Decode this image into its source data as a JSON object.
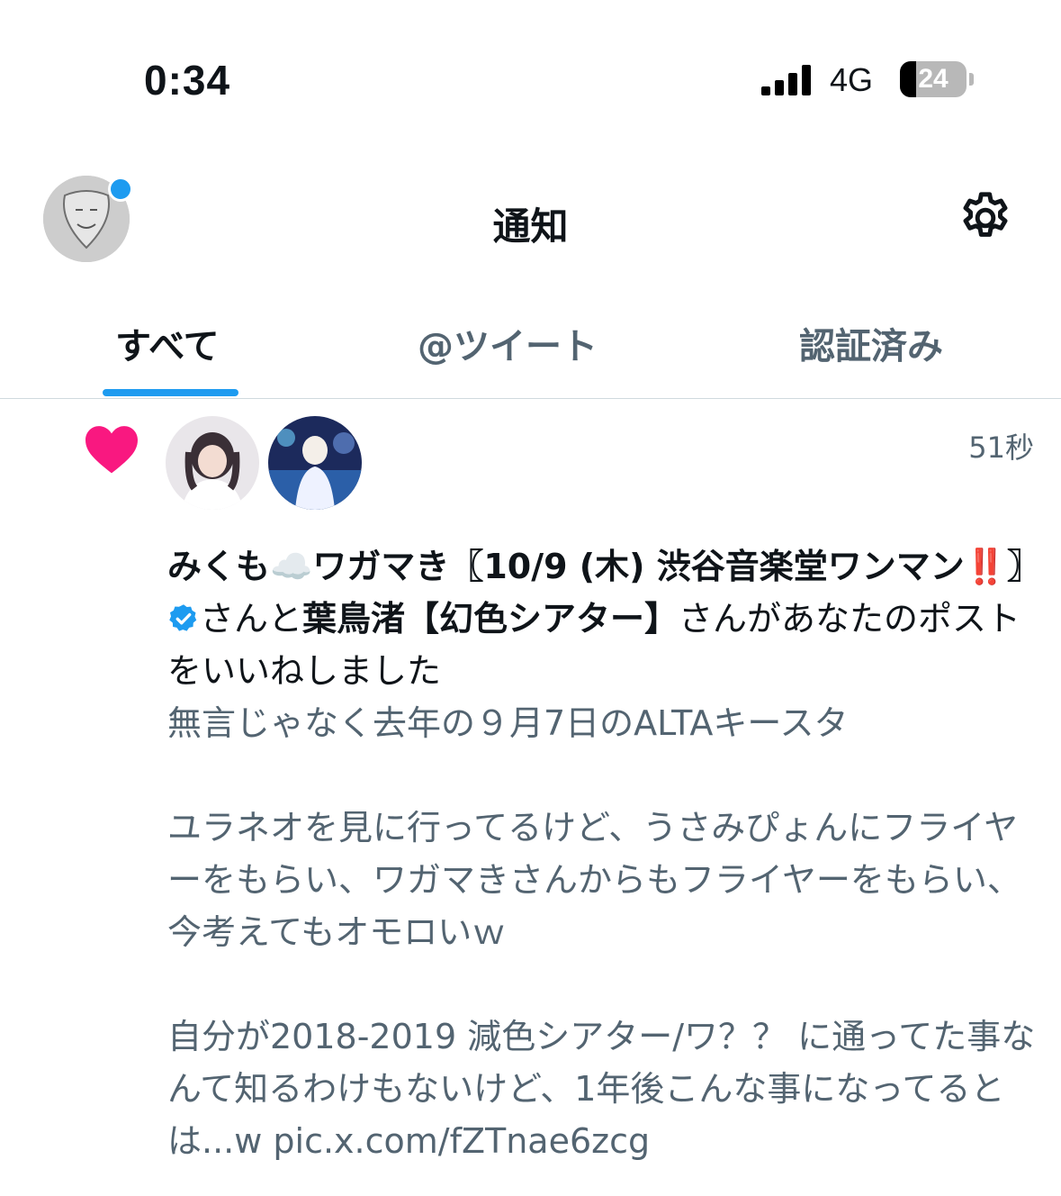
{
  "status_bar": {
    "time": "0:34",
    "network": "4G",
    "battery": "24",
    "battery_level": 0.24
  },
  "header": {
    "title": "通知"
  },
  "tabs": [
    {
      "label": "すべて",
      "active": true
    },
    {
      "label": "@ツイート",
      "active": false
    },
    {
      "label": "認証済み",
      "active": false
    }
  ],
  "notification": {
    "time_ago": "51秒",
    "liker1": "みくも☁️ワガマき〖10/9 (木) 渋谷音楽堂ワンマン‼️〗",
    "connector": "さんと",
    "liker2": "葉鳥渚【幻色シアター】",
    "action": "さんがあなたのポストをいいねしました",
    "tweet_text": "無言じゃなく去年の９月7日のALTAキースタ\n\nユラネオを見に行ってるけど、うさみぴょんにフライヤーをもらい、ワガマきさんからもフライヤーをもらい、今考えてもオモロいｗ\n\n自分が2018-2019 減色シアター/ワ？？ に通ってた事なんて知るわけもないけど、1年後こんな事になってるとは...w pic.x.com/fZTnae6zcg"
  },
  "colors": {
    "accent": "#1d9bf0",
    "like": "#f91880",
    "secondary_text": "#536471"
  }
}
